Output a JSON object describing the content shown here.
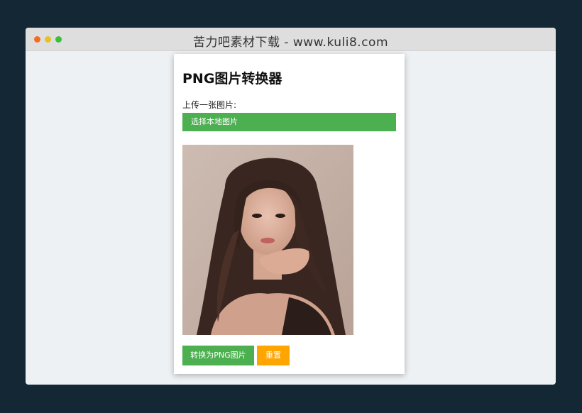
{
  "window": {
    "title": "苦力吧素材下载 - www.kuli8.com"
  },
  "app": {
    "title": "PNG图片转换器",
    "upload_label": "上传一张图片:",
    "file_button_label": "选择本地图片",
    "convert_button_label": "转换为PNG图片",
    "reset_button_label": "重置"
  },
  "colors": {
    "page_background": "#132735",
    "primary_green": "#4caf50",
    "reset_orange": "#ffa500"
  }
}
